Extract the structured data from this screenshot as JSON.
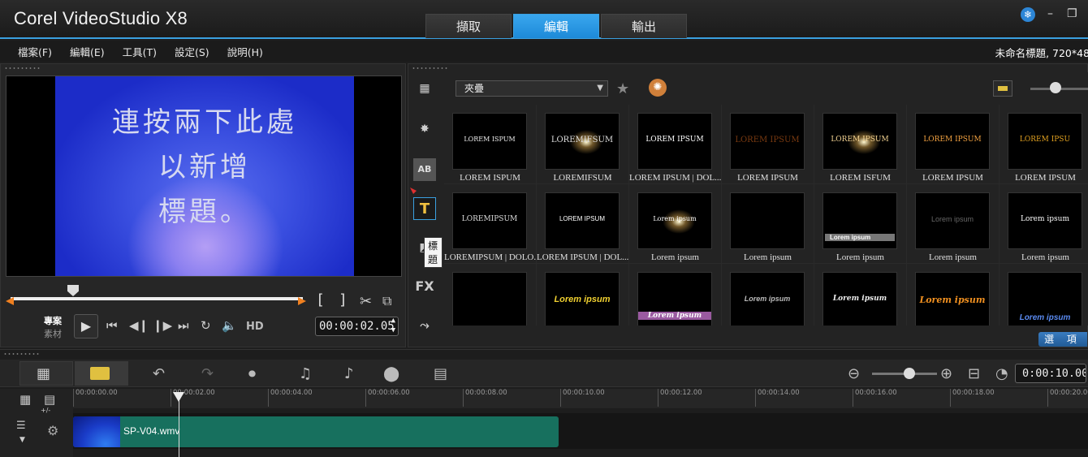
{
  "app": {
    "title": "Corel VideoStudio X8",
    "tabs": [
      "擷取",
      "編輯",
      "輸出"
    ],
    "active_tab": "編輯",
    "project_info": "未命名標題, 720*480"
  },
  "menu": [
    "檔案(F)",
    "編輯(E)",
    "工具(T)",
    "設定(S)",
    "說明(H)"
  ],
  "player": {
    "preview_text": [
      "連按兩下此處",
      "以新增",
      "標題。"
    ],
    "mode_project": "專案",
    "mode_clip": "素材",
    "hd_label": "HD",
    "timecode": "00:00:02.05"
  },
  "library": {
    "category": "夾疊",
    "tooltip": "標題",
    "options_label": "選 項",
    "rows": [
      [
        {
          "label": "LOREM ISPUM",
          "preview": "LOREM ISPUM"
        },
        {
          "label": "LOREMIFSUM",
          "preview": "LOREMIFSUM"
        },
        {
          "label": "LOREM IPSUM | DOL...",
          "preview": "LOREM IPSUM"
        },
        {
          "label": "LOREM IPSUM",
          "preview": "LOREM IPSUM"
        },
        {
          "label": "LOREM ISFUM",
          "preview": "LOREM IPSUM"
        },
        {
          "label": "LOREM IPSUM",
          "preview": "LOREM IPSUM"
        },
        {
          "label": "LOREM IPSUM",
          "preview": "LOREM IPSU"
        }
      ],
      [
        {
          "label": "LOREMIPSUM | DOLO...",
          "preview": "LOREMIPSUM"
        },
        {
          "label": "LOREM IPSUM | DOL...",
          "preview": "LOREM IPSUM"
        },
        {
          "label": "Lorem ipsum",
          "preview": "Lorem ipsum"
        },
        {
          "label": "Lorem ipsum",
          "preview": ""
        },
        {
          "label": "Lorem ipsum",
          "preview": "Lorem ipsum"
        },
        {
          "label": "Lorem ipsum",
          "preview": "Lorem ipsum"
        },
        {
          "label": "Lorem ipsum",
          "preview": "Lorem ipsum"
        }
      ],
      [
        {
          "label": "",
          "preview": ""
        },
        {
          "label": "",
          "preview": "Lorem ipsum"
        },
        {
          "label": "",
          "preview": "Lorem ipsum"
        },
        {
          "label": "",
          "preview": "Lorem ipsum"
        },
        {
          "label": "",
          "preview": "Lorem ipsum"
        },
        {
          "label": "",
          "preview": "Lorem ipsum"
        },
        {
          "label": "",
          "preview": "Lorem ipsum"
        }
      ]
    ]
  },
  "timeline": {
    "timecode": "0:00:10.00",
    "ticks": [
      "00:00:00.00",
      "00:00:02.00",
      "00:00:04.00",
      "00:00:06.00",
      "00:00:08.00",
      "00:00:10.00",
      "00:00:12.00",
      "00:00:14.00",
      "00:00:16.00",
      "00:00:18.00",
      "00:00:20.00"
    ],
    "add_remove_label": "+/-",
    "clip_name": "SP-V04.wmv"
  },
  "colors": {
    "accent": "#3aa0e0",
    "clip": "#17705e",
    "trim": "#f08020"
  }
}
